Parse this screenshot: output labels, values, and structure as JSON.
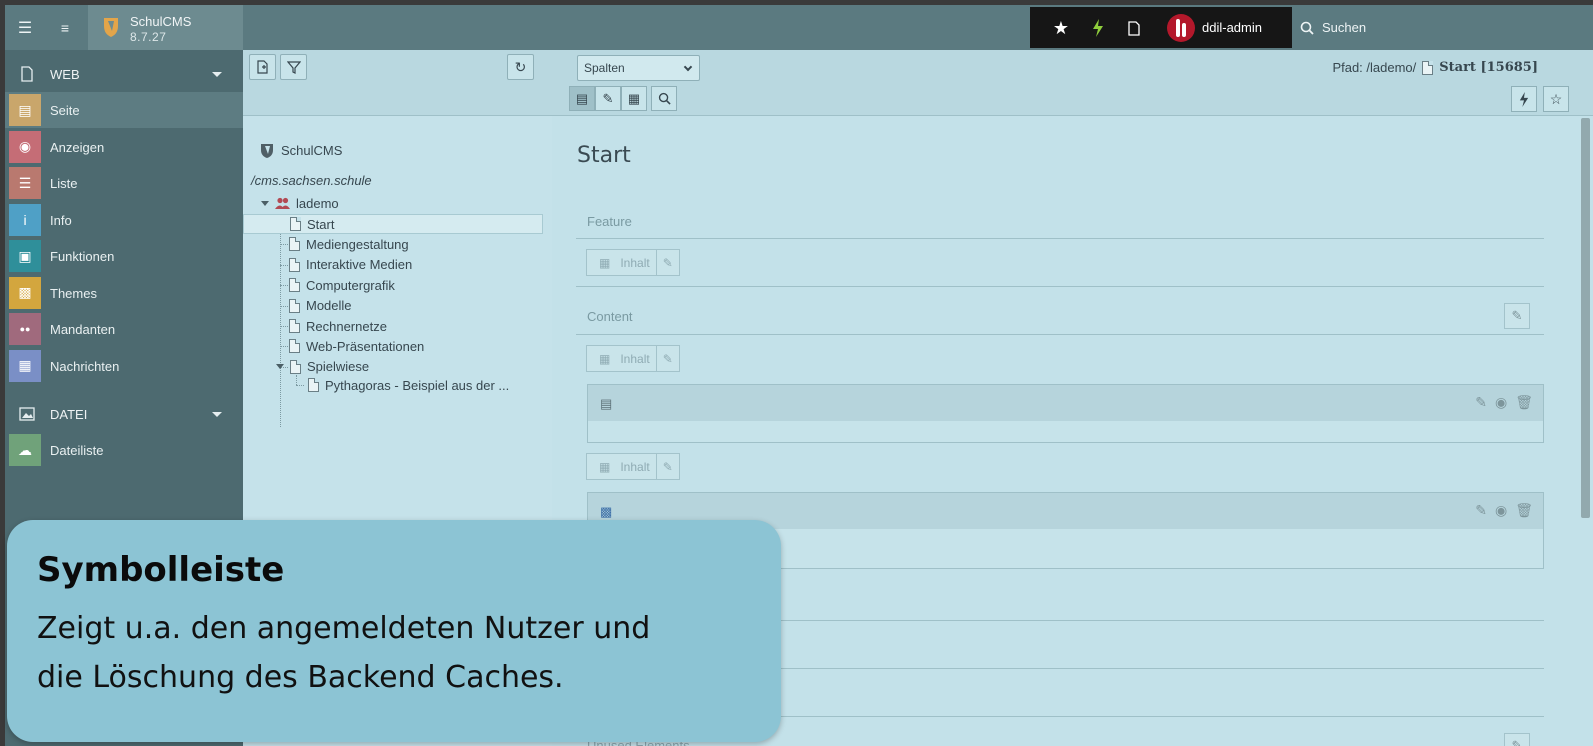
{
  "topbar": {
    "app_name": "SchulCMS",
    "version": "8.7.27",
    "username": "ddil-admin",
    "search_label": "Suchen"
  },
  "modules": {
    "web_group": "WEB",
    "items": [
      {
        "label": "Seite",
        "icon": "page-module-icon",
        "color": "#c9a66b"
      },
      {
        "label": "Anzeigen",
        "icon": "eye-icon",
        "color": "#c56d76"
      },
      {
        "label": "Liste",
        "icon": "list-icon",
        "color": "#b9796f"
      },
      {
        "label": "Info",
        "icon": "info-icon",
        "color": "#4fa0c6"
      },
      {
        "label": "Funktionen",
        "icon": "toolbox-icon",
        "color": "#2f8f9a"
      },
      {
        "label": "Themes",
        "icon": "box-icon",
        "color": "#d3a63e"
      },
      {
        "label": "Mandanten",
        "icon": "users-icon",
        "color": "#a06a7d"
      },
      {
        "label": "Nachrichten",
        "icon": "news-icon",
        "color": "#7a8fc6"
      }
    ],
    "file_group": "DATEI",
    "file_items": [
      {
        "label": "Dateiliste",
        "icon": "cloud-icon",
        "color": "#70a27a"
      }
    ]
  },
  "tree": {
    "root": "SchulCMS",
    "domain": "/cms.sachsen.schule",
    "site": "lademo",
    "pages": [
      "Start",
      "Mediengestaltung",
      "Interaktive Medien",
      "Computergrafik",
      "Modelle",
      "Rechnernetze",
      "Web-Präsentationen",
      "Spielwiese"
    ],
    "subpage": "Pythagoras - Beispiel aus der ..."
  },
  "content": {
    "view_select": "Spalten",
    "path_label": "Pfad: /lademo/",
    "page_ref": "Start [15685]",
    "page_title": "Start",
    "col_feature": "Feature",
    "col_content": "Content",
    "add_content_label": "Inhalt",
    "col_unused": "Unused Elements"
  },
  "callout": {
    "title": "Symbolleiste",
    "line1": "Zeigt u.a. den angemeldeten Nutzer und",
    "line2": "die Löschung des Backend Caches."
  },
  "colors": {
    "topbar": "#5b7a80",
    "sidebar": "#4d6a70",
    "panel": "#c3e1e9",
    "callout": "#8cc4d4",
    "flash": "#8fce3c"
  }
}
